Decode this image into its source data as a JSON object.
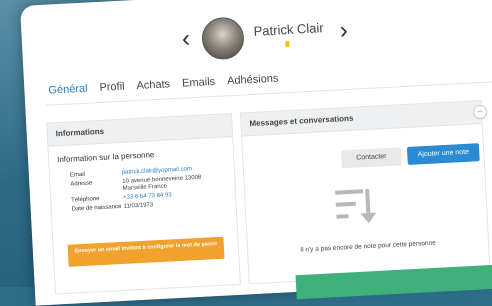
{
  "header": {
    "prev_arrow": "‹",
    "next_arrow": "›",
    "person_name": "Patrick Clair"
  },
  "tabs": [
    {
      "label": "Général",
      "active": true
    },
    {
      "label": "Profil",
      "active": false
    },
    {
      "label": "Achats",
      "active": false
    },
    {
      "label": "Emails",
      "active": false
    },
    {
      "label": "Adhésions",
      "active": false
    }
  ],
  "info_panel": {
    "title": "Informations",
    "subtitle": "Information sur la personne",
    "rows": [
      {
        "key": "Email",
        "value": "patrick.clair@yopmail.com"
      },
      {
        "key": "Adresse",
        "value": "10 avenue bonneveine 13008 Marseille France"
      },
      {
        "key": "Téléphone",
        "value": "+33 6 64 73 84 93"
      },
      {
        "key": "Date de naissance",
        "value": "11/03/1973"
      }
    ],
    "invite_button": "Envoyer un email invitant à configurer le mot de passe"
  },
  "messages_panel": {
    "title": "Messages et conversations",
    "collapse_symbol": "−",
    "contact_button": "Contacter",
    "add_note_button": "Ajouter une note",
    "empty_message": "Il n'y a pas encore de note pour cette personne"
  },
  "colors": {
    "accent": "#2a7bc1",
    "primary_button": "#2a8ad4",
    "warning_button": "#f0a22c",
    "status_dot": "#f2c200"
  }
}
